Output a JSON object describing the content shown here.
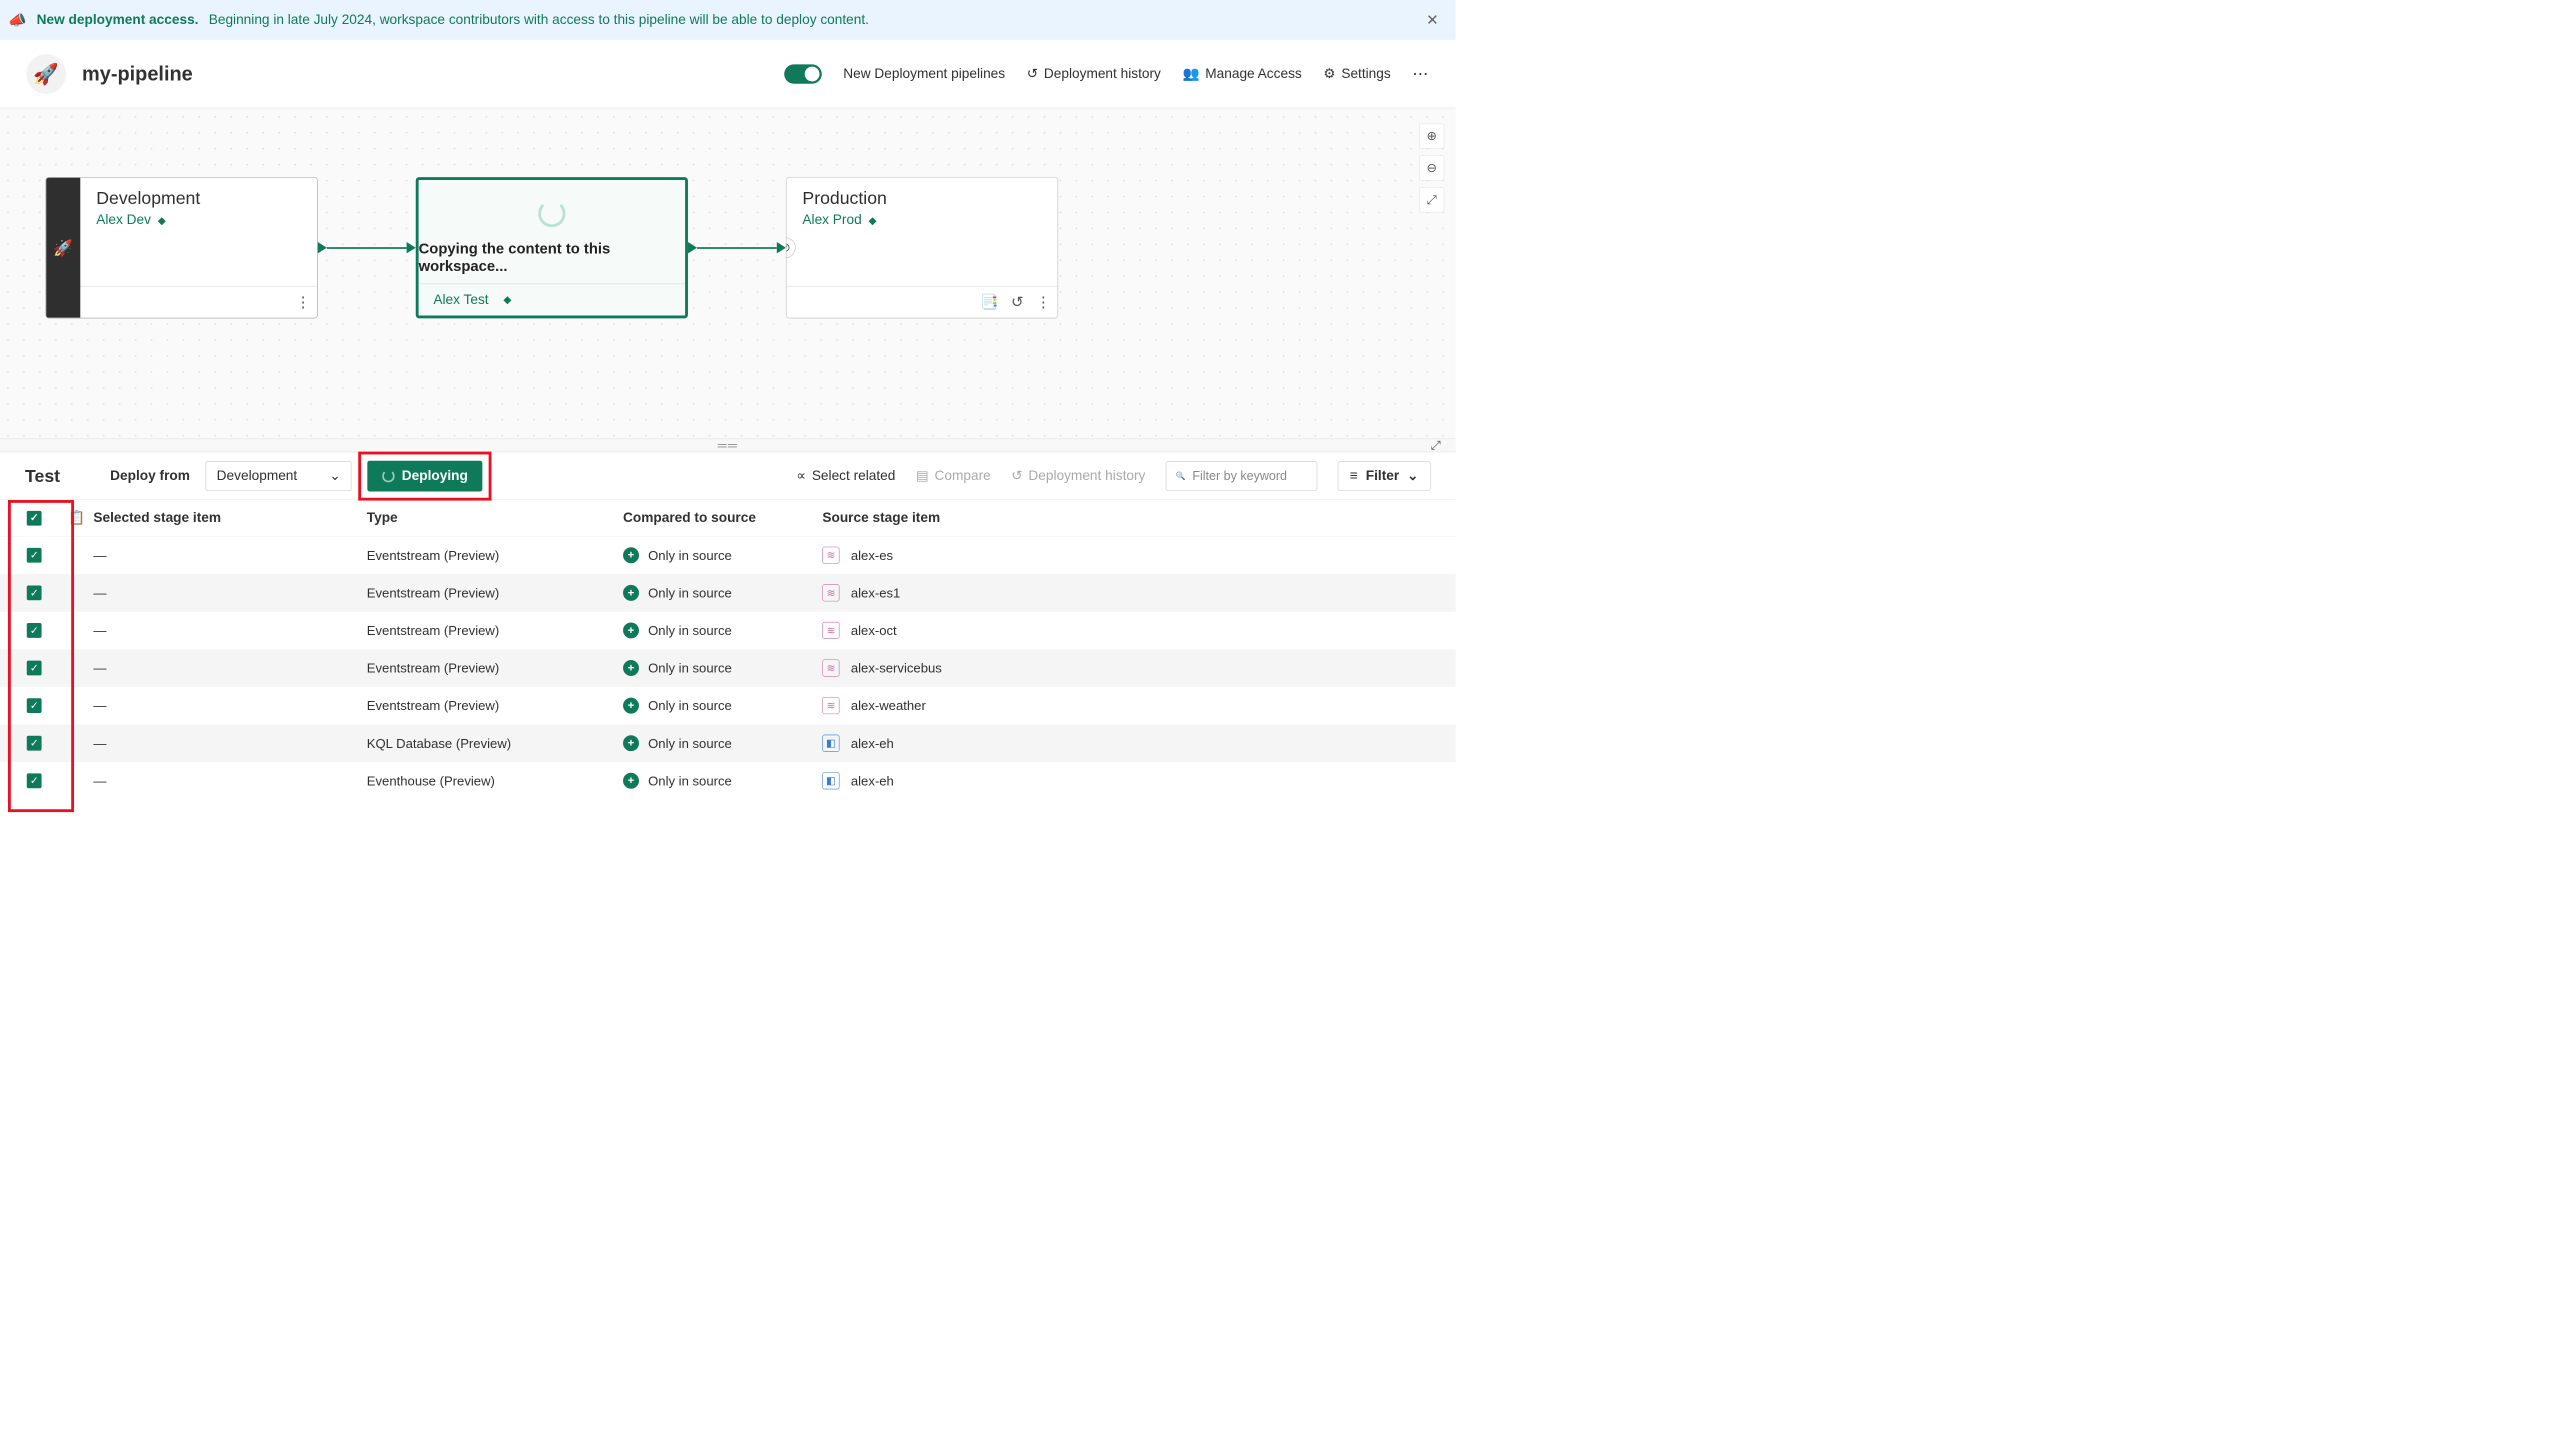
{
  "banner": {
    "title": "New deployment access.",
    "message": "Beginning in late July 2024, workspace contributors with access to this pipeline will be able to deploy content."
  },
  "header": {
    "pipeline_name": "my-pipeline",
    "new_pipelines_label": "New Deployment pipelines",
    "history_label": "Deployment history",
    "manage_access_label": "Manage Access",
    "settings_label": "Settings"
  },
  "stages": {
    "dev": {
      "title": "Development",
      "workspace": "Alex Dev"
    },
    "test": {
      "copying_text": "Copying the content to this workspace...",
      "workspace": "Alex Test"
    },
    "prod": {
      "title": "Production",
      "workspace": "Alex Prod"
    }
  },
  "toolbar": {
    "stage_title": "Test",
    "deploy_from_label": "Deploy from",
    "deploy_from_value": "Development",
    "deploy_button_label": "Deploying",
    "select_related_label": "Select related",
    "compare_label": "Compare",
    "history_label": "Deployment history",
    "search_placeholder": "Filter by keyword",
    "filter_label": "Filter"
  },
  "table": {
    "headers": {
      "selected": "Selected stage item",
      "type": "Type",
      "compared": "Compared to source",
      "source": "Source stage item"
    },
    "rows": [
      {
        "selected": "—",
        "type": "Eventstream (Preview)",
        "compared": "Only in source",
        "source": "alex-es",
        "iconClass": "es"
      },
      {
        "selected": "—",
        "type": "Eventstream (Preview)",
        "compared": "Only in source",
        "source": "alex-es1",
        "iconClass": "es"
      },
      {
        "selected": "—",
        "type": "Eventstream (Preview)",
        "compared": "Only in source",
        "source": "alex-oct",
        "iconClass": "es"
      },
      {
        "selected": "—",
        "type": "Eventstream (Preview)",
        "compared": "Only in source",
        "source": "alex-servicebus",
        "iconClass": "es"
      },
      {
        "selected": "—",
        "type": "Eventstream (Preview)",
        "compared": "Only in source",
        "source": "alex-weather",
        "iconClass": "es"
      },
      {
        "selected": "—",
        "type": "KQL Database (Preview)",
        "compared": "Only in source",
        "source": "alex-eh",
        "iconClass": "db"
      },
      {
        "selected": "—",
        "type": "Eventhouse (Preview)",
        "compared": "Only in source",
        "source": "alex-eh",
        "iconClass": "db"
      }
    ]
  }
}
